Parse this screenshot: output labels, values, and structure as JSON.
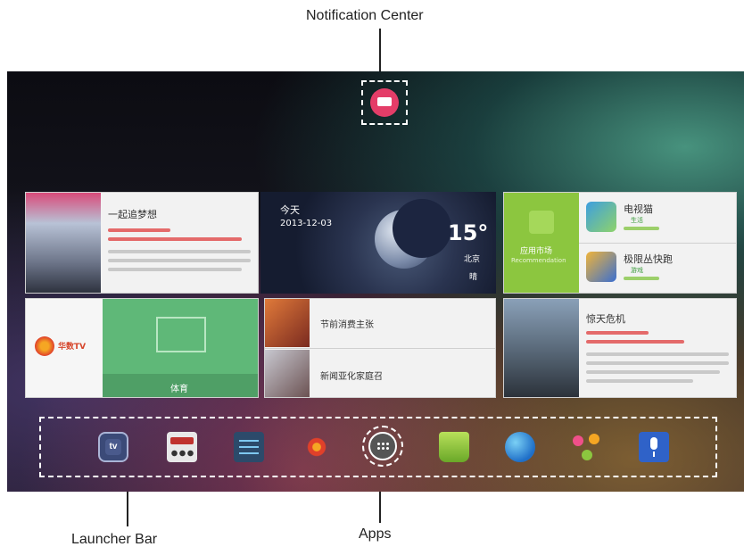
{
  "callouts": {
    "notification_center": "Notification Center",
    "launcher_bar": "Launcher Bar",
    "apps": "Apps"
  },
  "tiles": {
    "music": {
      "title": "一起追梦想"
    },
    "weather": {
      "label": "今天",
      "date": "2013-12-03",
      "temp": "15°",
      "city": "北京",
      "condition": "晴"
    },
    "market": {
      "label": "应用市场",
      "sub": "Recommendation"
    },
    "app1": {
      "name": "电视猫",
      "cat": "生活"
    },
    "app2": {
      "name": "极限丛快跑",
      "cat": "游戏"
    },
    "sports_logo": "华数TV",
    "sports_label": "体育",
    "news1": "节前消费主张",
    "news2": "新闻亚化家庭召",
    "movie_title": "惊天危机"
  },
  "launcher": {
    "items": [
      "tv-icon",
      "media-icon",
      "settings-icon",
      "huashu-icon",
      "apps-icon",
      "store-icon",
      "browser-icon",
      "share-icon",
      "voice-icon"
    ]
  },
  "colors": {
    "accent_pink": "#e43d68",
    "market_green": "#8cc63f",
    "voice_blue": "#2f62c8"
  }
}
